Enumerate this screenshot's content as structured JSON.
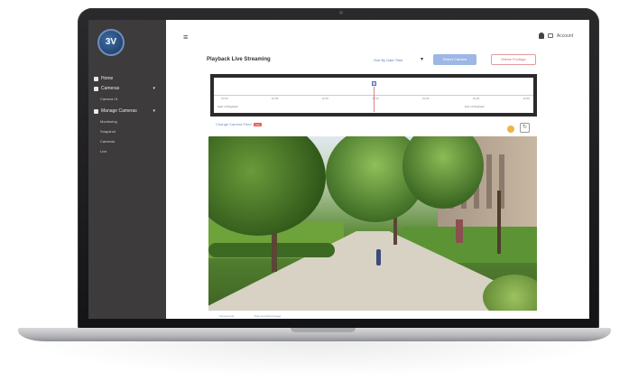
{
  "colors": {
    "sidebar_bg": "#3d3b3b",
    "accent_blue": "#9db7e6",
    "accent_red": "#e29a9a"
  },
  "sidebar": {
    "logo_text": "3V",
    "items": [
      {
        "label": "Home",
        "icon": "home-icon"
      },
      {
        "label": "Cameras",
        "icon": "camera-icon",
        "expandable": true
      },
      {
        "label": "Camera 01",
        "sub": true
      },
      {
        "label": "Manage Cameras",
        "icon": "gear-icon",
        "expandable": true
      },
      {
        "label": "Monitoring",
        "sub": true
      },
      {
        "label": "Snapshot",
        "sub": true
      },
      {
        "label": "Cameras",
        "sub": true
      },
      {
        "label": "Live",
        "sub": true
      }
    ]
  },
  "topbar": {
    "user_label": "Account"
  },
  "header": {
    "title": "Playback Live Streaming",
    "sort_label": "Sort By Date Time",
    "primary_button": "Select Camera",
    "outline_button": "Delete Footage"
  },
  "timeline": {
    "ticks": [
      "10:00",
      "10:05",
      "10:10",
      "10:15",
      "10:20",
      "10:25",
      "10:30"
    ],
    "start_label": "Start of Playback",
    "end_label": "End of Playback",
    "marker_position": 0.5
  },
  "camera_row": {
    "change_camera": "Change Camera Feed",
    "badge": "Live"
  },
  "footer": {
    "links": [
      "Camera info",
      "View recorded footage"
    ]
  }
}
